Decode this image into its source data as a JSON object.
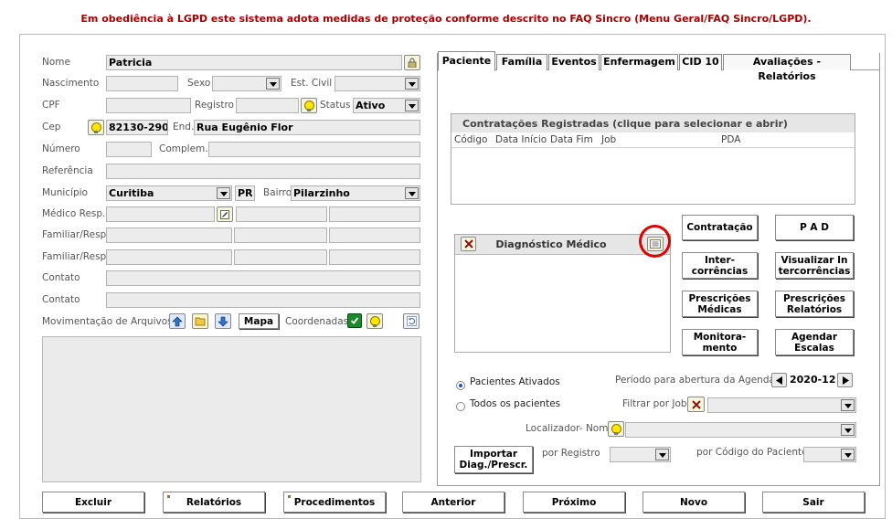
{
  "notice": "Em obediência à LGPD este sistema adota medidas de proteção conforme descrito no FAQ Sincro (Menu Geral/FAQ Sincro/LGPD).",
  "form": {
    "nome_label": "Nome",
    "nome_value": "Patricia",
    "nascimento_label": "Nascimento",
    "sexo_label": "Sexo",
    "estcivil_label": "Est. Civil",
    "cpf_label": "CPF",
    "registro_label": "Registro",
    "status_label": "Status",
    "status_value": "Ativo",
    "cep_label": "Cep",
    "cep_value": "82130-290",
    "end_label": "End.",
    "end_value": "Rua Eugênio Flor",
    "numero_label": "Número",
    "complem_label": "Complem.",
    "referencia_label": "Referência",
    "municipio_label": "Município",
    "municipio_value": "Curitiba",
    "uf_value": "PR",
    "bairro_label": "Bairro",
    "bairro_value": "Pilarzinho",
    "medico_label": "Médico Resp.",
    "familiar1_label": "Familiar/Resp",
    "familiar2_label": "Familiar/Resp.",
    "contato1_label": "Contato",
    "contato2_label": "Contato",
    "movimentacao_label": "Movimentação de Arquivos",
    "mapa_label": "Mapa",
    "coordenadas_label": "Coordenadas"
  },
  "tabs": [
    "Paciente",
    "Família",
    "Eventos",
    "Enfermagem",
    "CID 10",
    "Avaliações - Relatórios"
  ],
  "contracts": {
    "title": "Contratações Registradas (clique para selecionar e abrir)",
    "columns": [
      "Código",
      "Data Início",
      "Data Fim",
      "Job",
      "PDA"
    ]
  },
  "diagnostico": {
    "title": "Diagnóstico Médico"
  },
  "actions": {
    "contratacao": "Contratação",
    "pad": "P A D",
    "inter_1": "Inter-",
    "inter_2": "corrências",
    "visualizar_1": "Visualizar In",
    "visualizar_2": "tercorrências",
    "prescmed_1": "Prescrições",
    "prescmed_2": "Médicas",
    "prescrel_1": "Prescrições",
    "prescrel_2": "Relatórios",
    "monit_1": "Monitora-",
    "monit_2": "mento",
    "agendar_1": "Agendar",
    "agendar_2": "Escalas"
  },
  "filters": {
    "ativados_label": "Pacientes Ativados",
    "todos_label": "Todos os pacientes",
    "periodo_label": "Período para abertura da Agenda",
    "periodo_value": "2020-12",
    "job_label": "Filtrar por Job",
    "localizador_label": "Localizador- Nome",
    "importar_1": "Importar",
    "importar_2": "Diag./Prescr.",
    "registro_label": "por Registro",
    "codigo_label": "por Código do Paciente"
  },
  "bottom": [
    "Excluir",
    "Relatórios",
    "Procedimentos",
    "Anterior",
    "Próximo",
    "Novo",
    "Sair"
  ],
  "colors": {
    "notice": "#a80000",
    "highlight_circle": "#e00000",
    "field_bg": "#ececec"
  }
}
